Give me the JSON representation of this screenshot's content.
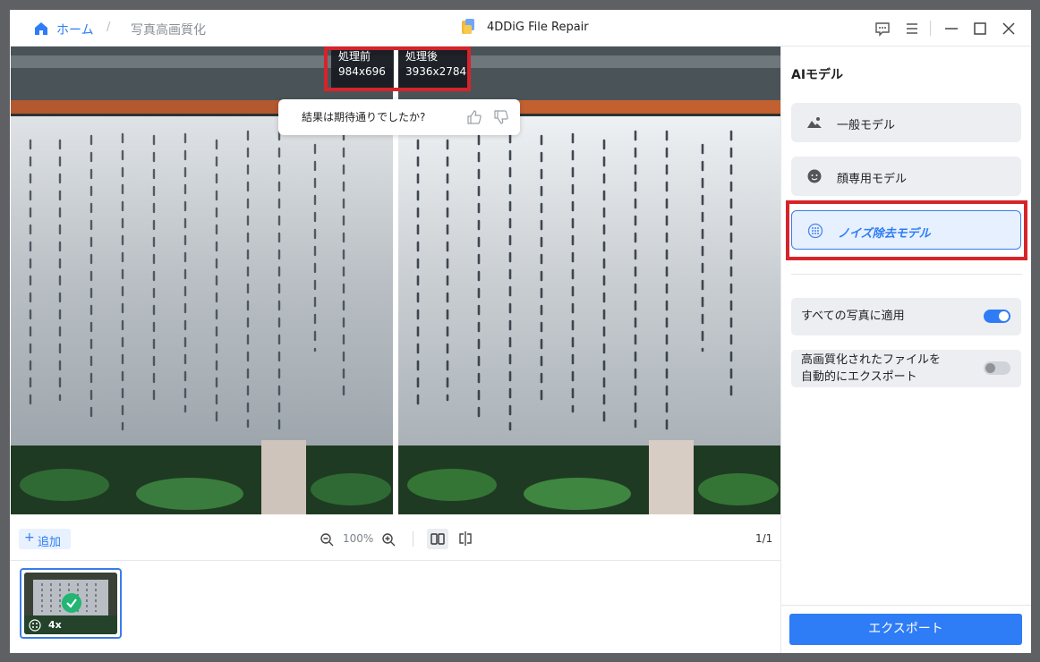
{
  "breadcrumb": {
    "home_label": "ホーム",
    "separator": "/",
    "current": "写真高画質化"
  },
  "app": {
    "title": "4DDiG File Repair"
  },
  "titlebar_icons": [
    "feedback-icon",
    "menu-icon",
    "minimize-icon",
    "maximize-icon",
    "close-icon"
  ],
  "preview": {
    "before": {
      "title": "処理前",
      "size": "984x696"
    },
    "after": {
      "title": "処理後",
      "size": "3936x2784"
    },
    "feedback_prompt": "結果は期待通りでしたか?"
  },
  "toolbar": {
    "add_label": "追加",
    "add_symbol": "+",
    "zoom": "100%",
    "page": "1/1"
  },
  "thumbnails": [
    {
      "scale": "4x",
      "done": true
    }
  ],
  "panel": {
    "title": "AIモデル",
    "models": [
      {
        "label": "一般モデル",
        "icon": "landscape-icon",
        "active": false
      },
      {
        "label": "顔専用モデル",
        "icon": "face-icon",
        "active": false
      },
      {
        "label": "ノイズ除去モデル",
        "icon": "denoise-icon",
        "active": true
      }
    ],
    "apply_all": {
      "label": "すべての写真に適用",
      "on": true
    },
    "auto_export": {
      "label_line1": "高画質化されたファイルを",
      "label_line2": "自動的にエクスポート",
      "on": false
    },
    "export_label": "エクスポート"
  },
  "colors": {
    "accent": "#2e7cf6",
    "highlight": "#d6242a",
    "success": "#22b573"
  }
}
